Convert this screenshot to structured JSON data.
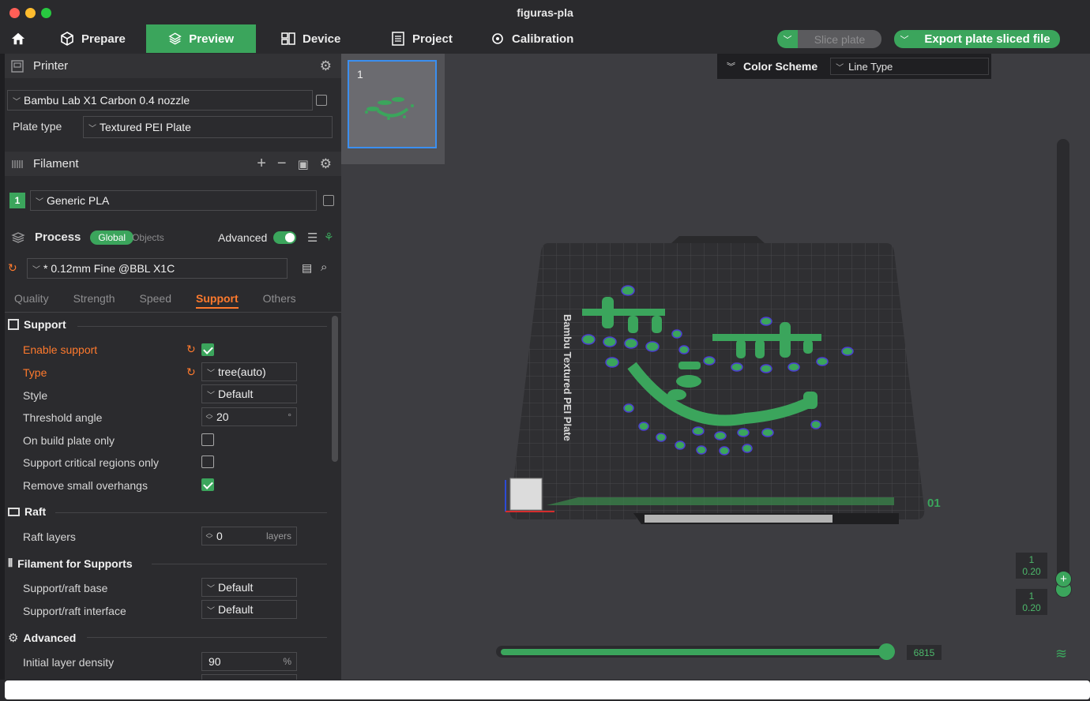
{
  "window": {
    "title": "figuras-pla"
  },
  "menu": {
    "prepare": "Prepare",
    "preview": "Preview",
    "device": "Device",
    "project": "Project",
    "calibration": "Calibration",
    "slice_plate": "Slice plate",
    "export": "Export plate sliced file"
  },
  "printer": {
    "header": "Printer",
    "model": "Bambu Lab X1 Carbon 0.4 nozzle",
    "plate_type_label": "Plate type",
    "plate_type": "Textured PEI Plate"
  },
  "filament": {
    "header": "Filament",
    "slot": "1",
    "name": "Generic PLA"
  },
  "process": {
    "header": "Process",
    "global": "Global",
    "objects": "Objects",
    "advanced": "Advanced",
    "preset": "* 0.12mm Fine @BBL X1C",
    "tabs": [
      "Quality",
      "Strength",
      "Speed",
      "Support",
      "Others"
    ],
    "active_tab": "Support"
  },
  "support": {
    "group": "Support",
    "enable_support": "Enable support",
    "enable_support_checked": true,
    "type_label": "Type",
    "type_value": "tree(auto)",
    "style_label": "Style",
    "style_value": "Default",
    "threshold_label": "Threshold angle",
    "threshold_value": "20",
    "threshold_unit": "°",
    "build_plate_only": "On build plate only",
    "critical_regions": "Support critical regions only",
    "remove_overhangs": "Remove small overhangs",
    "remove_overhangs_checked": true
  },
  "raft": {
    "group": "Raft",
    "layers_label": "Raft layers",
    "layers_value": "0",
    "layers_unit": "layers"
  },
  "filament_supports": {
    "group": "Filament for Supports",
    "base_label": "Support/raft base",
    "base_value": "Default",
    "interface_label": "Support/raft interface",
    "interface_value": "Default"
  },
  "advanced": {
    "group": "Advanced",
    "density_label": "Initial layer density",
    "density_value": "90",
    "density_unit": "%"
  },
  "preview": {
    "plate_number": "1",
    "color_scheme_label": "Color Scheme",
    "color_scheme_value": "Line Type",
    "plate_label": "Bambu Textured PEI Plate",
    "plate_id": "01",
    "layer_top": "1",
    "layer_top_height": "0.20",
    "layer_bottom": "1",
    "layer_bottom_height": "0.20",
    "moves": "6815"
  },
  "colors": {
    "accent": "#3ba55c",
    "modified": "#ff7a2d",
    "selection": "#3b8ff0"
  }
}
